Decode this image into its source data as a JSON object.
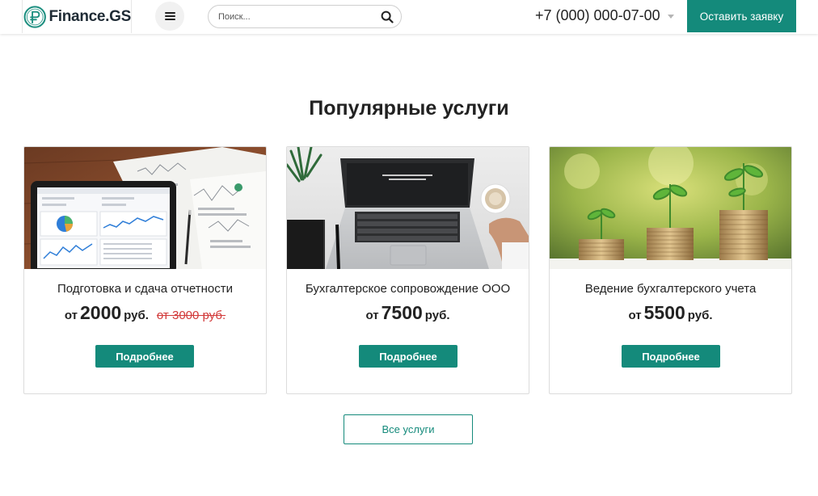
{
  "header": {
    "logo_text": "Finance.GS",
    "search_placeholder": "Поиск...",
    "phone": "+7 (000) 000-07-00",
    "cta_label": "Оставить заявку",
    "accent_color": "#148a7b"
  },
  "section": {
    "title": "Популярные услуги",
    "cards": [
      {
        "title": "Подготовка и сдача отчетности",
        "price_prefix": "от",
        "price_amount": "2000",
        "price_unit": "руб.",
        "old_price": "от 3000 руб.",
        "button_label": "Подробнее",
        "image": "tablet-with-financial-charts"
      },
      {
        "title": "Бухгалтерское сопровождение ООО",
        "price_prefix": "от",
        "price_amount": "7500",
        "price_unit": "руб.",
        "button_label": "Подробнее",
        "image": "laptop-and-coffee"
      },
      {
        "title": "Ведение бухгалтерского учета",
        "price_prefix": "от",
        "price_amount": "5500",
        "price_unit": "руб.",
        "button_label": "Подробнее",
        "image": "coin-stacks-with-sprouts"
      }
    ],
    "all_services_label": "Все услуги"
  }
}
